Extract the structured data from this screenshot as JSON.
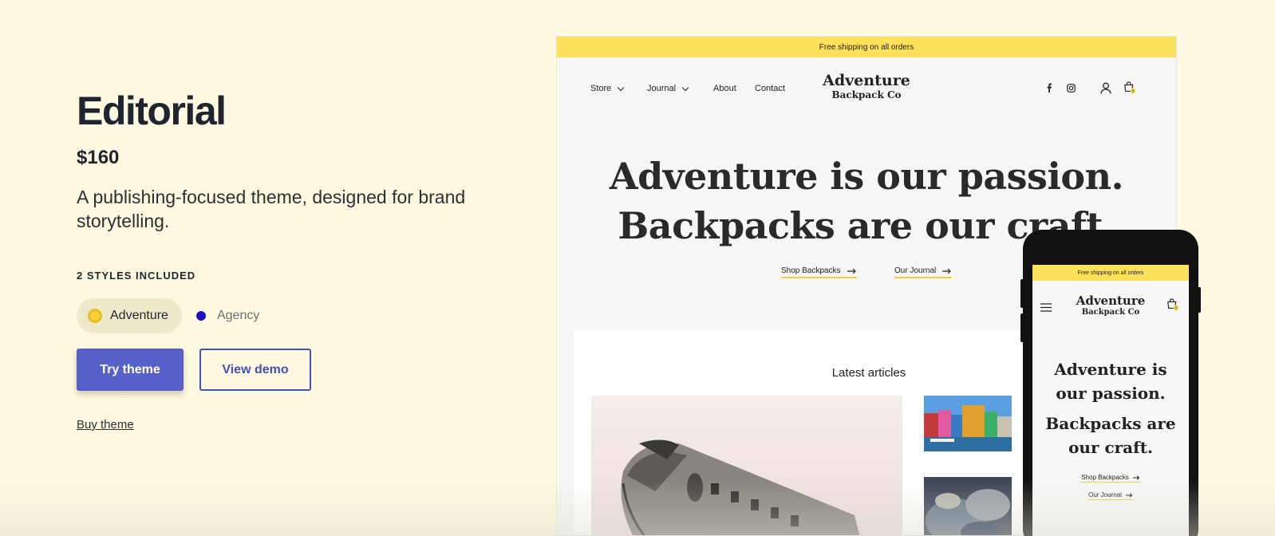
{
  "theme": {
    "name": "Editorial",
    "price": "$160",
    "description": "A publishing-focused theme, designed for brand storytelling.",
    "styles_label": "2 STYLES INCLUDED",
    "styles": [
      {
        "label": "Adventure",
        "color": "#f5d23a",
        "selected": true
      },
      {
        "label": "Agency",
        "color": "#1a10c8",
        "selected": false
      }
    ],
    "try_label": "Try theme",
    "demo_label": "View demo",
    "buy_label": "Buy theme"
  },
  "desktop": {
    "announcement": "Free shipping on all orders",
    "nav": [
      "Store",
      "Journal",
      "About",
      "Contact"
    ],
    "logo_line1": "Adventure",
    "logo_line2": "Backpack Co",
    "cart_count": "0",
    "hero_line1": "Adventure is our passion.",
    "hero_line2": "Backpacks are our craft.",
    "link_shop": "Shop Backpacks",
    "link_journal": "Our Journal",
    "articles_title": "Latest articles"
  },
  "mobile": {
    "announcement": "Free shipping on all orders",
    "logo_line1": "Adventure",
    "logo_line2": "Backpack Co",
    "cart_count": "0",
    "hero1_a": "Adventure is",
    "hero1_b": "our passion.",
    "hero2_a": "Backpacks are",
    "hero2_b": "our craft.",
    "link_shop": "Shop Backpacks",
    "link_journal": "Our Journal"
  },
  "colors": {
    "page_bg": "#fef9e0",
    "accent": "#5560c8",
    "announcement": "#fde15a"
  }
}
